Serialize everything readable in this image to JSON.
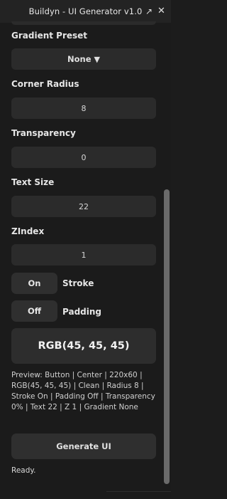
{
  "window": {
    "title": "Buildyn - UI Generator v1.0",
    "popout_icon": "popout-icon",
    "close_icon": "close-icon"
  },
  "gradient": {
    "label": "Gradient Preset",
    "value": "None",
    "arrow": "▼"
  },
  "corner": {
    "label": "Corner Radius",
    "value": "8"
  },
  "transparency": {
    "label": "Transparency",
    "value": "0"
  },
  "text_size": {
    "label": "Text Size",
    "value": "22"
  },
  "zindex": {
    "label": "ZIndex",
    "value": "1"
  },
  "stroke": {
    "state": "On",
    "label": "Stroke"
  },
  "padding": {
    "state": "Off",
    "label": "Padding"
  },
  "preview": {
    "swatch_text": "RGB(45, 45, 45)",
    "description": "Preview: Button | Center | 220x60 | RGB(45, 45, 45) | Clean | Radius 8 | Stroke On | Padding Off | Transparency 0% | Text 22 | Z 1 | Gradient None"
  },
  "generate_label": "Generate UI",
  "status": "Ready.",
  "colors": {
    "background": "#1b1b1b",
    "field": "#2b2b2b",
    "swatch": "#2d2d2d"
  }
}
